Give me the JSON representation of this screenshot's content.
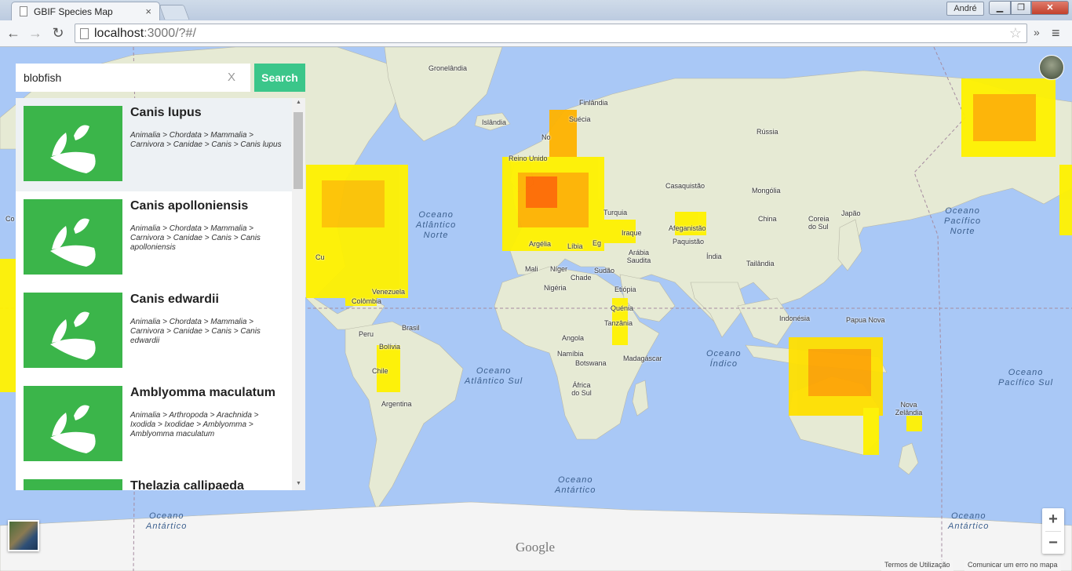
{
  "browser": {
    "tab_title": "GBIF Species Map",
    "tab_close": "×",
    "user_badge": "André",
    "win_min": "▁",
    "win_max": "❐",
    "win_close": "✕",
    "url_host": "localhost",
    "url_rest": ":3000/?#/",
    "back_glyph": "←",
    "forward_glyph": "→",
    "reload_glyph": "↻",
    "star_glyph": "☆",
    "more_glyph": "»",
    "menu_glyph": "≡"
  },
  "search": {
    "value": "blobfish",
    "clear_label": "X",
    "button_label": "Search"
  },
  "results": [
    {
      "name": "Canis lupus",
      "taxonomy": "Animalia > Chordata > Mammalia > Carnivora > Canidae > Canis > Canis lupus",
      "active": true
    },
    {
      "name": "Canis apolloniensis",
      "taxonomy": "Animalia > Chordata > Mammalia > Carnivora > Canidae > Canis > Canis apolloniensis",
      "active": false
    },
    {
      "name": "Canis edwardii",
      "taxonomy": "Animalia > Chordata > Mammalia > Carnivora > Canidae > Canis > Canis edwardii",
      "active": false
    },
    {
      "name": "Amblyomma maculatum",
      "taxonomy": "Animalia > Arthropoda > Arachnida > Ixodida > Ixodidae > Amblyomma > Amblyomma maculatum",
      "active": false
    },
    {
      "name": "Thelazia callipaeda",
      "taxonomy": "",
      "active": false
    }
  ],
  "map": {
    "places": {
      "greenland": "Gronelândia",
      "iceland": "Islândia",
      "finland": "Finlândia",
      "sweden": "Suécia",
      "norway": "No",
      "russia": "Rússia",
      "uk": "Reino Unido",
      "kazakhstan": "Casaquistão",
      "mongolia": "Mongólia",
      "turkey": "Turquia",
      "china": "China",
      "korea": "Coreia do Sul",
      "japan": "Japão",
      "afghanistan": "Afeganistão",
      "pakistan": "Paquistão",
      "iraq": "Iraque",
      "saudi": "Arábia Saudita",
      "egypt": "Eg",
      "india": "Índia",
      "thailand": "Tailândia",
      "algeria": "Argélia",
      "libya": "Líbia",
      "mali": "Mali",
      "niger": "Níger",
      "chad": "Chade",
      "sudan": "Sudão",
      "nigeria": "Nigéria",
      "ethiopia": "Etiópia",
      "kenya": "Quénia",
      "tanzania": "Tanzânia",
      "angola": "Angola",
      "namibia": "Namíbia",
      "botswana": "Botswana",
      "madagascar": "Madagáscar",
      "south_africa": "África do Sul",
      "venezuela": "Venezuela",
      "colombia": "Colômbia",
      "brazil": "Brasil",
      "peru": "Peru",
      "bolivia": "Bolívia",
      "chile": "Chile",
      "argentina": "Argentina",
      "indonesia": "Indonésia",
      "png": "Papua Nova",
      "nz": "Nova Zelândia",
      "mexico_edge": "Cu",
      "left_edge": "Co"
    },
    "oceans": {
      "north_atlantic": "Oceano\nAtlântico\nNorte",
      "south_atlantic": "Oceano\nAtlântico Sul",
      "indian": "Oceano\nÍndico",
      "north_pacific": "Oceano\nPacífico\nNorte",
      "south_pacific": "Oceano\nPacífico Sul",
      "antarctic_center": "Oceano\nAntártico",
      "antarctic_left": "Oceano\nAntártico",
      "antarctic_right": "Oceano\nAntártico"
    },
    "zoom_in": "+",
    "zoom_out": "−",
    "google_logo": "Google",
    "terms_link": "Termos de Utilização",
    "report_link": "Comunicar um erro no mapa"
  },
  "colors": {
    "accent": "#3bc68a",
    "thumb": "#3bb54a",
    "ocean": "#a9c8f6",
    "land": "#e8ecd8",
    "heat_low": "#fff200",
    "heat_mid": "#ffb300",
    "heat_high": "#ff6a00"
  }
}
